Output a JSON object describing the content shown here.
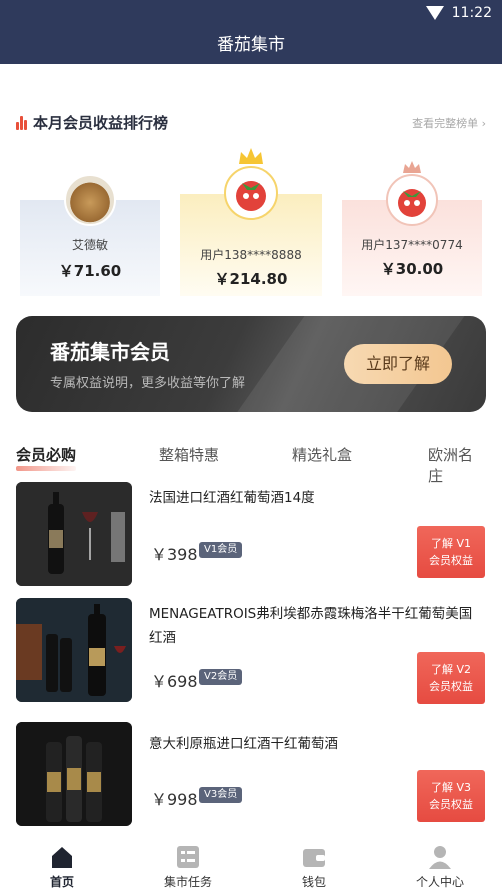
{
  "status_bar": {
    "time": "11:22"
  },
  "navbar": {
    "title": "番茄集市"
  },
  "ranking": {
    "title": "本月会员收益排行榜",
    "more_link": "查看完整榜单 ›",
    "entries": [
      {
        "place": 2,
        "name": "艾德敏",
        "amount": "￥71.60"
      },
      {
        "place": 1,
        "name": "用户138****8888",
        "amount": "￥214.80"
      },
      {
        "place": 3,
        "name": "用户137****0774",
        "amount": "￥30.00"
      }
    ],
    "colors": {
      "first": "#fbeebf",
      "second": "#e2e8f2",
      "third": "#fbe1dc",
      "accent": "#e8503a"
    }
  },
  "banner": {
    "title": "番茄集市会员",
    "subtitle": "专属权益说明，更多收益等你了解",
    "button_label": "立即了解"
  },
  "tabs": [
    {
      "label": "会员必购",
      "active": true
    },
    {
      "label": "整箱特惠",
      "active": false
    },
    {
      "label": "精选礼盒",
      "active": false
    },
    {
      "label": "欧洲名庄",
      "active": false
    }
  ],
  "products": [
    {
      "name": "法国进口红酒红葡萄酒14度",
      "price": "￥398",
      "badge": "V1会员",
      "cta_line1": "了解 V1",
      "cta_line2": "会员权益"
    },
    {
      "name": "MENAGEATROIS弗利埃都赤霞珠梅洛半干红葡萄美国红酒",
      "price": "￥698",
      "badge": "V2会员",
      "cta_line1": "了解 V2",
      "cta_line2": "会员权益"
    },
    {
      "name": "意大利原瓶进口红酒干红葡萄酒",
      "price": "￥998",
      "badge": "V3会员",
      "cta_line1": "了解 V3",
      "cta_line2": "会员权益"
    }
  ],
  "bottom_nav": [
    {
      "label": "首页",
      "icon": "home-icon",
      "active": true
    },
    {
      "label": "集市任务",
      "icon": "task-list-icon",
      "active": false
    },
    {
      "label": "钱包",
      "icon": "wallet-icon",
      "active": false
    },
    {
      "label": "个人中心",
      "icon": "user-icon",
      "active": false
    }
  ],
  "colors": {
    "header_bg": "#2f3a5c",
    "cta_red": "#e64b41",
    "banner_button": "#f3c791"
  }
}
